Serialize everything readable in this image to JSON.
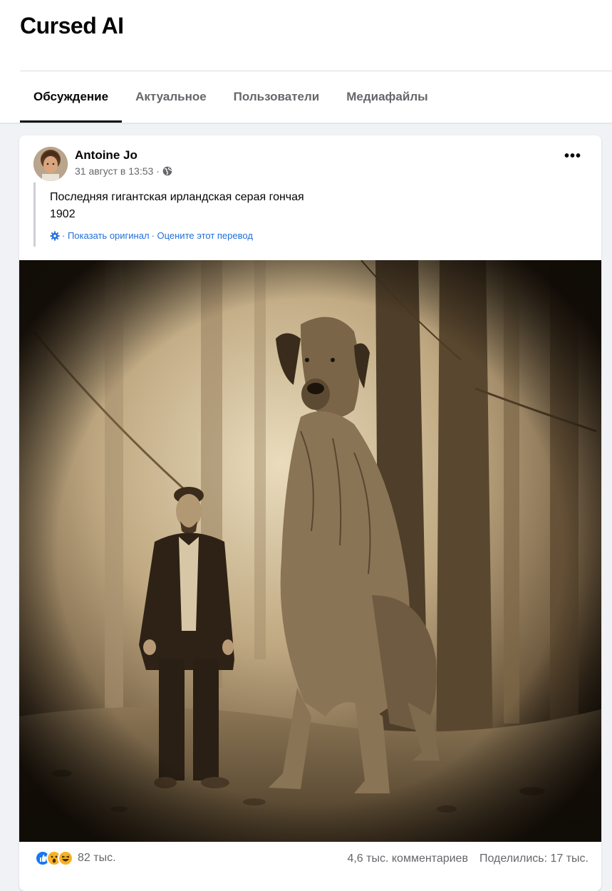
{
  "group": {
    "title": "Cursed AI"
  },
  "tabs": [
    {
      "label": "Обсуждение",
      "active": true
    },
    {
      "label": "Актуальное",
      "active": false
    },
    {
      "label": "Пользователи",
      "active": false
    },
    {
      "label": "Медиафайлы",
      "active": false
    }
  ],
  "post": {
    "author": "Antoine Jo",
    "date": "31 август в 13:53 ·",
    "privacy_icon": "globe-icon",
    "more_icon": "more-options-icon",
    "text_line1": "Последняя гигантская ирландская серая гончая",
    "text_line2": "1902",
    "translation": {
      "icon": "gear-icon",
      "show_original": "· Показать оригинал",
      "rate": "· Оцените этот перевод"
    },
    "photo_icon": "sepia-photo-man-and-giant-dog"
  },
  "stats": {
    "reactions": [
      "like",
      "wow",
      "haha"
    ],
    "reactions_count": "82 тыс.",
    "comments": "4,6 тыс. комментариев",
    "shares": "Поделились: 17 тыс."
  },
  "colors": {
    "accent": "#216fdb",
    "like": "#1877f2",
    "wow": "#f7b125",
    "text_secondary": "#65676b"
  }
}
